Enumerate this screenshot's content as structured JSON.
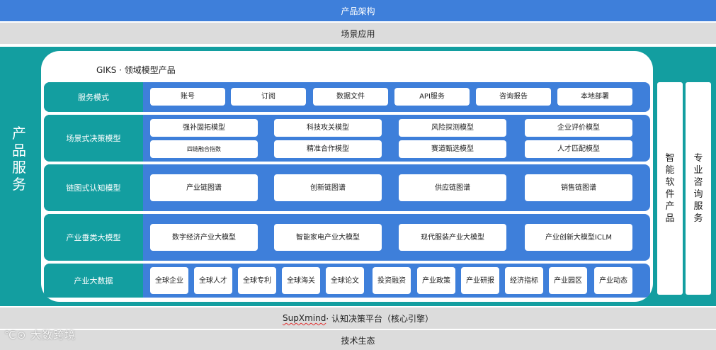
{
  "top_band": "产品架构",
  "scene_band": "场景应用",
  "product_label": [
    "产",
    "品",
    "服",
    "务"
  ],
  "giks_title": "GIKS · 领域模型产品",
  "rows": {
    "service": {
      "label": "服务模式",
      "cells": [
        "账号",
        "订阅",
        "数据文件",
        "API服务",
        "咨询报告",
        "本地部署"
      ]
    },
    "scenario": {
      "label": "场景式决策模型",
      "top": [
        "强补固拓模型",
        "科技攻关模型",
        "风险探测模型",
        "企业评价模型"
      ],
      "bottom": [
        "四链融合指数",
        "精准合作模型",
        "赛道甄选模型",
        "人才匹配模型"
      ]
    },
    "chain": {
      "label": "链图式认知模型",
      "cells": [
        "产业链图谱",
        "创新链图谱",
        "供应链图谱",
        "销售链图谱"
      ]
    },
    "vertical": {
      "label": "产业垂类大模型",
      "cells": [
        "数字经济产业大模型",
        "智能家电产业大模型",
        "现代服装产业大模型",
        "产业创新大模型ICLM"
      ]
    },
    "bigdata": {
      "label": "产业大数据",
      "cells": [
        [
          "全球",
          "企业"
        ],
        [
          "全球",
          "人才"
        ],
        [
          "全球",
          "专利"
        ],
        [
          "全球",
          "海关"
        ],
        [
          "全球",
          "论文"
        ],
        [
          "投资",
          "融资"
        ],
        [
          "产业",
          "政策"
        ],
        [
          "产业",
          "研报"
        ],
        [
          "经济",
          "指标"
        ],
        [
          "产业",
          "园区"
        ],
        [
          "产业",
          "动态"
        ]
      ]
    }
  },
  "side": {
    "smart_software": [
      "智",
      "能",
      "软",
      "件",
      "产",
      "品"
    ],
    "consulting": [
      "专",
      "业",
      "咨",
      "询",
      "服",
      "务"
    ]
  },
  "platform_band": {
    "brand": "SupXmind",
    "rest": " · 认知决策平台（核心引擎）"
  },
  "tech_band": "技术生态",
  "watermark": "大数跨境"
}
